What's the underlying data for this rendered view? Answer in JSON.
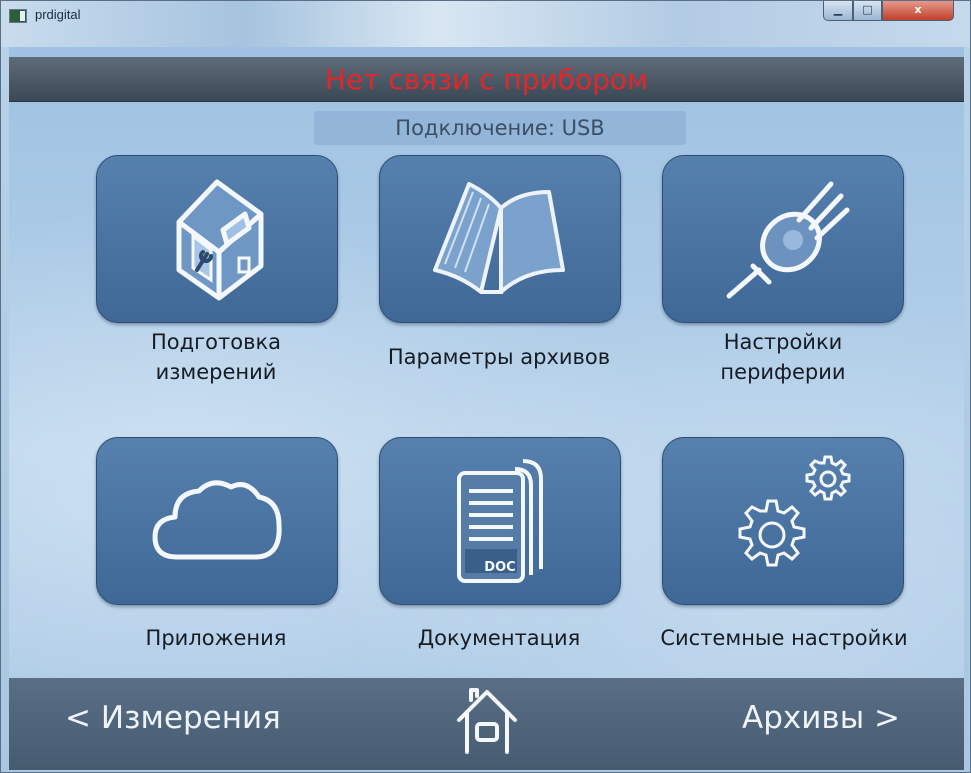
{
  "window": {
    "title": "prdigital",
    "min_glyph": "▁",
    "max_glyph": "□",
    "close_glyph": "x"
  },
  "status": {
    "message": "Нет связи с прибором",
    "message_color": "#e3262a",
    "connection": "Подключение: USB"
  },
  "tiles": [
    {
      "label_1": "Подготовка",
      "label_2": "измерений",
      "icon": "house-wrench-icon"
    },
    {
      "label_1": "Параметры архивов",
      "label_2": "",
      "icon": "open-book-icon"
    },
    {
      "label_1": "Настройки",
      "label_2": "периферии",
      "icon": "plug-icon"
    },
    {
      "label_1": "Приложения",
      "label_2": "",
      "icon": "cloud-icon"
    },
    {
      "label_1": "Документация",
      "label_2": "",
      "icon": "doc-icon",
      "doc_text": "DOC"
    },
    {
      "label_1": "Системные настройки",
      "label_2": "",
      "icon": "gears-icon"
    }
  ],
  "nav": {
    "prev": "< Измерения",
    "next": "Архивы >",
    "home_icon": "home-icon"
  }
}
